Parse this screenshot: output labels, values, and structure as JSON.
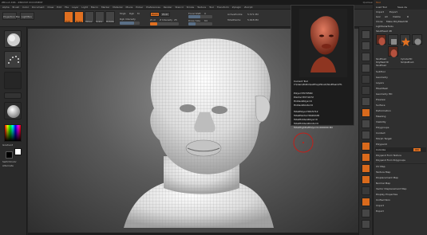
{
  "titlebar": {
    "text": "ZBrush 4R6 - ZBRUSH DOCUMENT",
    "menus": [
      "Quicksave",
      "See-through",
      "Menus",
      "DefaultZScript"
    ]
  },
  "menubar": {
    "items": [
      "Alpha",
      "Brush",
      "Color",
      "Document",
      "Draw",
      "Edit",
      "File",
      "Layer",
      "Light",
      "Macro",
      "Marker",
      "Material",
      "Movie",
      "Picker",
      "Preferences",
      "Render",
      "Stencil",
      "Stroke",
      "Texture",
      "Tool",
      "Transform",
      "Zplugin",
      "Zscript"
    ]
  },
  "toolbar": {
    "projection_label": "Projection Master",
    "lightbox_label": "LightBox",
    "edit_label": "Edit",
    "draw_label": "Draw",
    "move_label": "Move",
    "scale_label": "Scale",
    "rotate_label": "Rotate",
    "mrgb_label": "Mrgb",
    "rgb_label": "Rgb",
    "m_label": "M",
    "zadd_label": "Zadd",
    "zsub_label": "Zsub",
    "zcut_label": "Zcut",
    "focal_shift_label": "Focal Shift",
    "focal_shift_value": "0",
    "draw_size_label": "Draw Size",
    "draw_size_value": "64",
    "z_intensity_label": "Z Intensity",
    "z_intensity_value": "25",
    "active_points_label": "ActivePoints:",
    "active_points_value": "5.571 Mil",
    "total_points_label": "TotalPoints:",
    "total_points_value": "5.618 Mil",
    "rgb_intensity_label": "Rgb Intensity"
  },
  "lefttray": {
    "gradient_label": "Gradient",
    "switch_color_label": "SwitchColor",
    "alternate_label": "Alternate"
  },
  "popup": {
    "current_tool": "Current Tool",
    "path": "C:\\Users\\Public\\Gallifray\\Zbrush\\SkullHead.ZTL",
    "polys": "Polys=5570560",
    "points": "Points=5571072",
    "hidden_polys": "HiddenPolys=0",
    "hidden_points": "HiddenPoints=0",
    "total_polys": "TotalPolys=5615712",
    "total_points": "TotalPoints=5620228",
    "total_hidden_polys": "TotalHiddenPolys=0",
    "total_hidden_points": "TotalHiddenPoints=0",
    "total_high_def": "TotalHighDefPolys=0.000000 Mil"
  },
  "rightpanel": {
    "top_items": [
      "Tool",
      "Load Tool",
      "Save As",
      "Import",
      "Export",
      "Goz",
      "All",
      "Visible",
      "R",
      "Clone",
      "Make PolyMesh3D",
      "Lightbox▸Tools",
      "SkullHead 48"
    ],
    "subtools": [
      "SkullHead",
      "Cylinder3D",
      "PolyMesh3D",
      "SimpleBrush",
      "SkullHead"
    ],
    "sections": [
      "SubTool",
      "Geometry",
      "Layers",
      "FiberMesh",
      "Geometry HD",
      "Preview",
      "Surface",
      "Deformation",
      "Masking",
      "Visibility",
      "Polygroups",
      "Contact",
      "Morph Target",
      "Polypaint",
      "Colorize",
      "Polypaint From Texture",
      "Polypaint From Polygroups",
      "UV Map",
      "Texture Map",
      "Displacement Map",
      "Normal Map",
      "Vector Displacement Map",
      "Display Properties",
      "Unified Skin",
      "Import",
      "Export"
    ],
    "colorize_on": "ON"
  },
  "colors": {
    "accent": "#e07021",
    "panel": "#2f2f2f",
    "canvas": "#6a6a6a",
    "skin": "#b5513e"
  }
}
